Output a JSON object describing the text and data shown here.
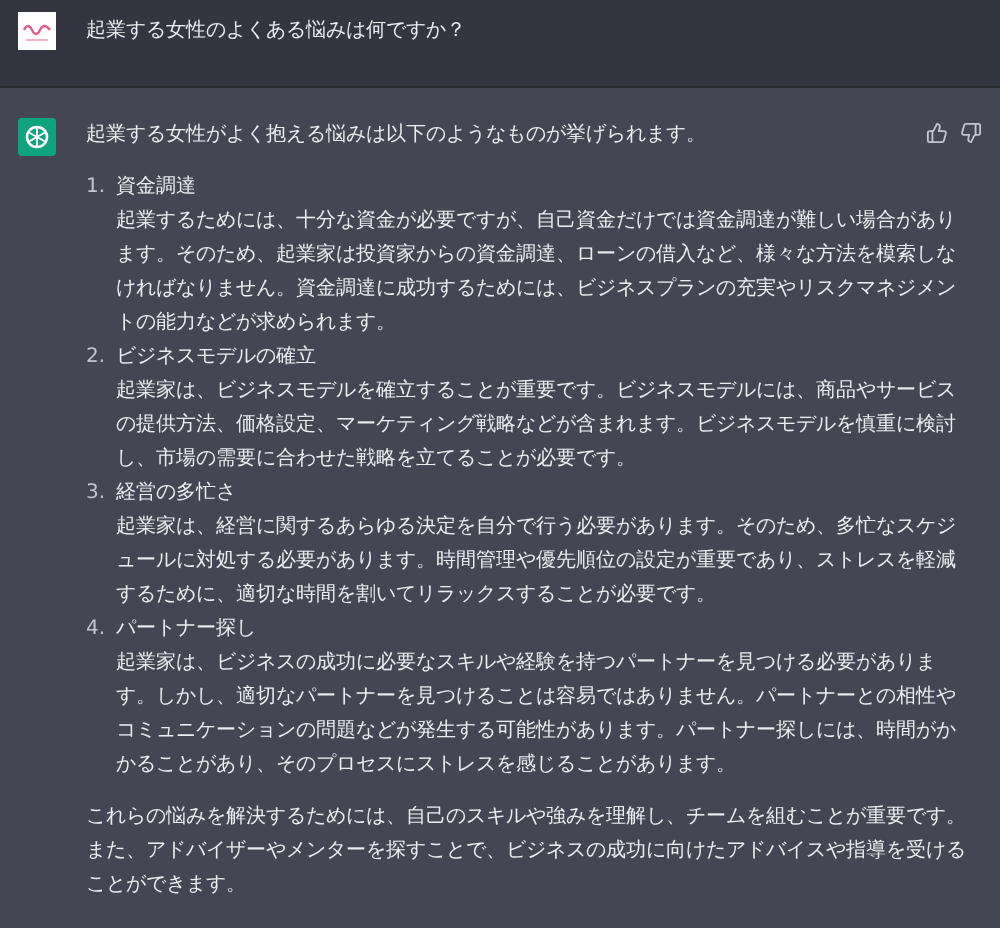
{
  "user_message": {
    "text": "起業する女性のよくある悩みは何ですか？"
  },
  "assistant_message": {
    "intro": "起業する女性がよく抱える悩みは以下のようなものが挙げられます。",
    "items": [
      {
        "number": "1.",
        "title": "資金調達",
        "body": "起業するためには、十分な資金が必要ですが、自己資金だけでは資金調達が難しい場合があります。そのため、起業家は投資家からの資金調達、ローンの借入など、様々な方法を模索しなければなりません。資金調達に成功するためには、ビジネスプランの充実やリスクマネジメントの能力などが求められます。"
      },
      {
        "number": "2.",
        "title": "ビジネスモデルの確立",
        "body": "起業家は、ビジネスモデルを確立することが重要です。ビジネスモデルには、商品やサービスの提供方法、価格設定、マーケティング戦略などが含まれます。ビジネスモデルを慎重に検討し、市場の需要に合わせた戦略を立てることが必要です。"
      },
      {
        "number": "3.",
        "title": "経営の多忙さ",
        "body": "起業家は、経営に関するあらゆる決定を自分で行う必要があります。そのため、多忙なスケジュールに対処する必要があります。時間管理や優先順位の設定が重要であり、ストレスを軽減するために、適切な時間を割いてリラックスすることが必要です。"
      },
      {
        "number": "4.",
        "title": "パートナー探し",
        "body": "起業家は、ビジネスの成功に必要なスキルや経験を持つパートナーを見つける必要があります。しかし、適切なパートナーを見つけることは容易ではありません。パートナーとの相性やコミュニケーションの問題などが発生する可能性があります。パートナー探しには、時間がかかることがあり、そのプロセスにストレスを感じることがあります。"
      }
    ],
    "conclusion": "これらの悩みを解決するためには、自己のスキルや強みを理解し、チームを組むことが重要です。また、アドバイザーやメンターを探すことで、ビジネスの成功に向けたアドバイスや指導を受けることができます。"
  }
}
